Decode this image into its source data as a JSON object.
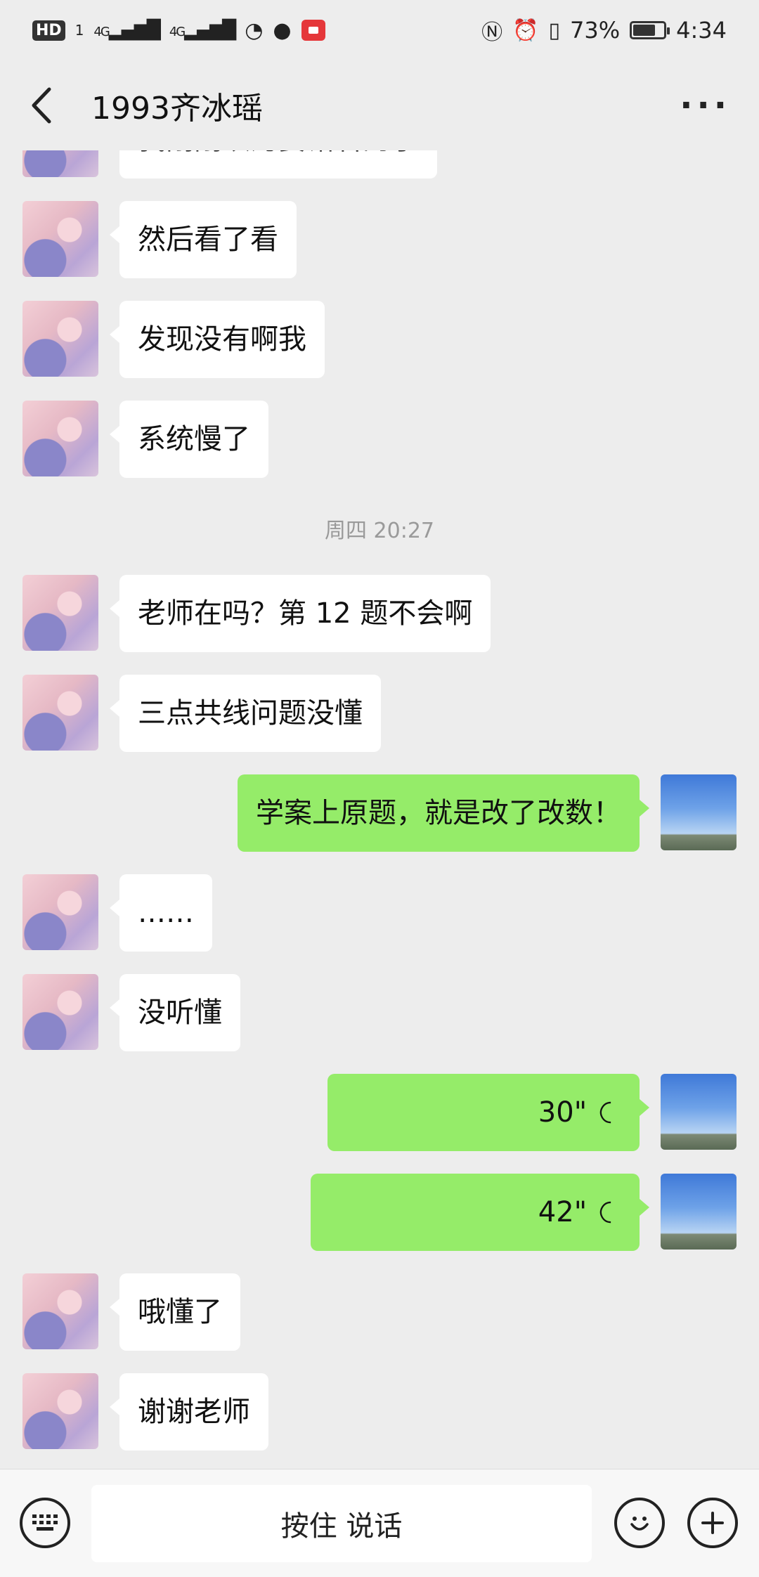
{
  "status_bar": {
    "hd": "HD",
    "sim_one": "1",
    "net_one": "4G",
    "net_two": "4G",
    "battery_level": 0.73,
    "battery_text": "73%",
    "time": "4:34"
  },
  "header": {
    "title": "1993齐冰瑶"
  },
  "messages": [
    {
      "side": "in",
      "text": "我刚刚以为要错看的了"
    },
    {
      "side": "in",
      "text": "然后看了看"
    },
    {
      "side": "in",
      "text": "发现没有啊我"
    },
    {
      "side": "in",
      "text": "系统慢了"
    },
    {
      "timestamp": "周四 20:27"
    },
    {
      "side": "in",
      "text": "老师在吗？第 12 题不会啊"
    },
    {
      "side": "in",
      "text": "三点共线问题没懂"
    },
    {
      "side": "out",
      "text": "学案上原题，就是改了改数！"
    },
    {
      "side": "in",
      "text": "……"
    },
    {
      "side": "in",
      "text": "没听懂"
    },
    {
      "side": "out",
      "voice": "30\""
    },
    {
      "side": "out",
      "voice": "42\""
    },
    {
      "side": "in",
      "text": "哦懂了"
    },
    {
      "side": "in",
      "text": "谢谢老师"
    }
  ],
  "input_bar": {
    "talk_label": "按住 说话"
  },
  "icons": {
    "back": "chevron-left-icon",
    "more": "more-dots-icon",
    "keyboard": "keyboard-icon",
    "emoji": "emoji-icon",
    "plus": "plus-icon",
    "voice": "voice-wave-icon"
  }
}
